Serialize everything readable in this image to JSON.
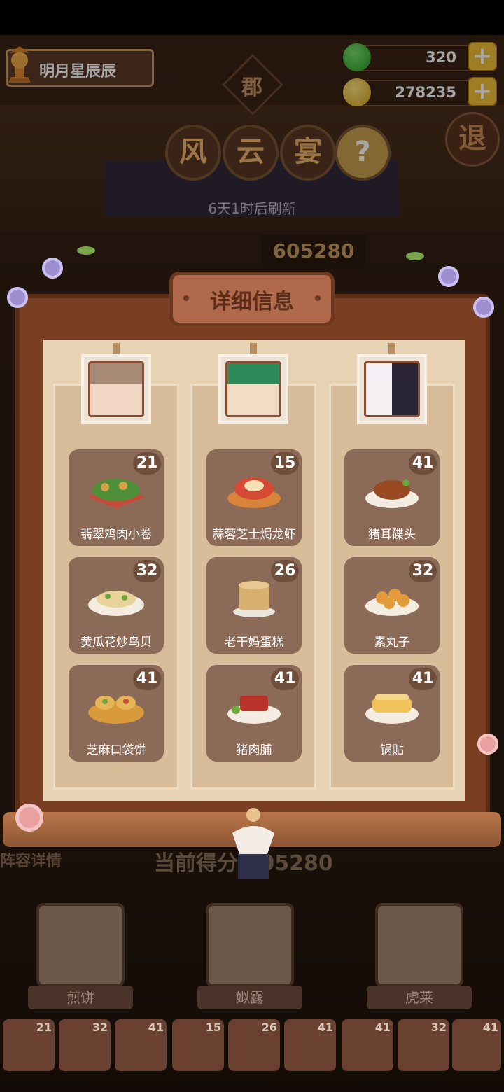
{
  "hud": {
    "player_name": "明月星辰辰",
    "apples": "320",
    "coins": "278235",
    "exit_label": "退"
  },
  "event": {
    "area_badge": "郡",
    "title_chars": [
      "风",
      "云",
      "宴"
    ],
    "help_label": "?",
    "refresh_text": "6天1时后刷新",
    "score": "605280"
  },
  "panel": {
    "title": "详细信息",
    "columns": [
      {
        "chef_icon": "chef-avatar-1",
        "dishes": [
          {
            "name": "翡翠鸡肉小卷",
            "level": "21"
          },
          {
            "name": "黄瓜花炒鸟贝",
            "level": "32"
          },
          {
            "name": "芝麻口袋饼",
            "level": "41"
          }
        ]
      },
      {
        "chef_icon": "chef-avatar-2",
        "dishes": [
          {
            "name": "蒜蓉芝士焗龙虾",
            "level": "15"
          },
          {
            "name": "老干妈蛋糕",
            "level": "26"
          },
          {
            "name": "猪肉脯",
            "level": "41"
          }
        ]
      },
      {
        "chef_icon": "chef-avatar-3",
        "dishes": [
          {
            "name": "猪耳碟头",
            "level": "41"
          },
          {
            "name": "素丸子",
            "level": "32"
          },
          {
            "name": "锅贴",
            "level": "41"
          }
        ]
      }
    ]
  },
  "bottom": {
    "section_label": "阵容详情",
    "current_score_label": "当前得分",
    "current_score": "605280",
    "chefs": [
      "煎饼",
      "姒露",
      "虎莱"
    ],
    "mini_levels": [
      "21",
      "32",
      "41",
      "15",
      "26",
      "41",
      "41",
      "32",
      "41"
    ]
  },
  "colors": {
    "accent_gold": "#f3c23a",
    "panel_wood": "#7a3e22",
    "card_brown": "#8b6a57"
  }
}
